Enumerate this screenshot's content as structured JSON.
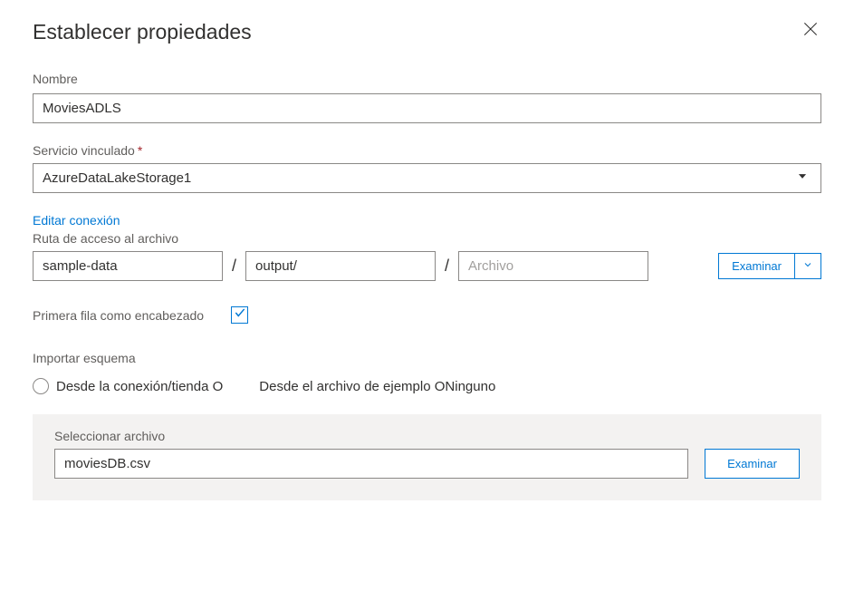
{
  "header": {
    "title": "Establecer propiedades"
  },
  "name": {
    "label": "Nombre",
    "value": "MoviesADLS"
  },
  "linkedService": {
    "label": "Servicio vinculado",
    "required": "*",
    "value": "AzureDataLakeStorage1",
    "editLink": "Editar conexión"
  },
  "filePath": {
    "label": "Ruta de acceso al archivo",
    "container": "sample-data",
    "folder": "output/",
    "filePlaceholder": "Archivo",
    "browseLabel": "Examinar"
  },
  "firstRowHeader": {
    "label": "Primera fila como encabezado",
    "checked": true
  },
  "importSchema": {
    "label": "Importar esquema",
    "options": {
      "fromConnection": "Desde la conexión/tienda O",
      "rest": "Desde el archivo de ejemplo ONinguno"
    }
  },
  "selectFile": {
    "label": "Seleccionar archivo",
    "value": "moviesDB.csv",
    "browseLabel": "Examinar"
  }
}
